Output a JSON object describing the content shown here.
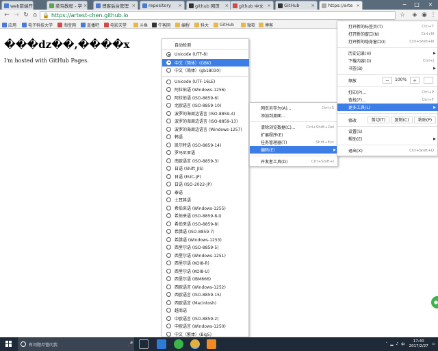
{
  "tabs": [
    {
      "title": "web前端开发"
    },
    {
      "title": "菜鸟教程 - 学"
    },
    {
      "title": "博客后台管理"
    },
    {
      "title": "repository"
    },
    {
      "title": "github 网页"
    },
    {
      "title": "github 中文"
    },
    {
      "title": "GitHub"
    },
    {
      "title": "https://arte"
    }
  ],
  "address": {
    "url": "https://artest-chen.github.io"
  },
  "bookmarks": [
    {
      "label": "应用"
    },
    {
      "label": "电子科技大学"
    },
    {
      "label": "淘宝网"
    },
    {
      "label": "直播吧"
    },
    {
      "label": "电影天堂"
    },
    {
      "label": "斗鱼"
    },
    {
      "label": "牛客网"
    },
    {
      "label": "编程"
    },
    {
      "label": "科大"
    },
    {
      "label": "GitHub"
    },
    {
      "label": "微软"
    },
    {
      "label": "博客"
    }
  ],
  "page": {
    "heading": "���dz��,����x",
    "body": "I'm hosted with GitHub Pages."
  },
  "encoding_menu": {
    "auto_detect": "自动检测",
    "items": [
      {
        "label": "Unicode (UTF-8)",
        "checked": true
      },
      {
        "label": "中文（简体）(GBK)",
        "selected": true
      },
      {
        "label": "中文（简体）(gb18030)"
      },
      {
        "label": "Unicode (UTF-16LE)"
      },
      {
        "label": "阿拉伯语 (Windows-1256)"
      },
      {
        "label": "阿拉伯语 (ISO-8859-6)"
      },
      {
        "label": "北欧语言 (ISO-8859-10)"
      },
      {
        "label": "波罗的海周边语言 (ISO-8859-4)"
      },
      {
        "label": "波罗的海周边语言 (ISO-8859-13)"
      },
      {
        "label": "波罗的海周边语言 (Windows-1257)"
      },
      {
        "label": "韩语"
      },
      {
        "label": "凯尔特语 (ISO-8859-14)"
      },
      {
        "label": "罗马尼亚语"
      },
      {
        "label": "南欧语言 (ISO-8859-3)"
      },
      {
        "label": "日语 (Shift_JIS)"
      },
      {
        "label": "日语 (EUC-JP)"
      },
      {
        "label": "日语 (ISO-2022-JP)"
      },
      {
        "label": "泰语"
      },
      {
        "label": "土耳其语"
      },
      {
        "label": "希伯来语 (Windows-1255)"
      },
      {
        "label": "希伯来语 (ISO-8859-8-I)"
      },
      {
        "label": "希伯来语 (ISO-8859-8)"
      },
      {
        "label": "希腊语 (ISO-8859-7)"
      },
      {
        "label": "希腊语 (Windows-1253)"
      },
      {
        "label": "西里尔语 (ISO-8859-5)"
      },
      {
        "label": "西里尔语 (Windows-1251)"
      },
      {
        "label": "西里尔语 (KOI8-R)"
      },
      {
        "label": "西里尔语 (KOI8-U)"
      },
      {
        "label": "西里尔语 (IBM866)"
      },
      {
        "label": "西欧语言 (Windows-1252)"
      },
      {
        "label": "西欧语言 (ISO-8859-15)"
      },
      {
        "label": "西欧语言 (Macintosh)"
      },
      {
        "label": "越南语"
      },
      {
        "label": "中欧语言 (ISO-8859-2)"
      },
      {
        "label": "中欧语言 (Windows-1250)"
      },
      {
        "label": "中文（繁体）(Big5)"
      }
    ]
  },
  "more_tools_menu": {
    "items": [
      {
        "label": "网页另存为(A)...",
        "shortcut": "Ctrl+S"
      },
      {
        "label": "添加到桌面..."
      },
      {
        "label": "清除浏览数据(C)...",
        "shortcut": "Ctrl+Shift+Del"
      },
      {
        "label": "扩展程序(E)"
      },
      {
        "label": "任务管理器(T)",
        "shortcut": "Shift+Esc"
      },
      {
        "label": "编码(E)",
        "highlighted": true
      },
      {
        "label": "开发者工具(D)",
        "shortcut": "Ctrl+Shift+I"
      }
    ]
  },
  "main_menu": {
    "new_tab": {
      "label": "打开新的标签页(T)",
      "shortcut": "Ctrl+T"
    },
    "new_window": {
      "label": "打开新的窗口(N)",
      "shortcut": "Ctrl+N"
    },
    "incognito": {
      "label": "打开新的隐身窗口(I)",
      "shortcut": "Ctrl+Shift+N"
    },
    "history": {
      "label": "历史记录(H)"
    },
    "downloads": {
      "label": "下载内容(D)",
      "shortcut": "Ctrl+J"
    },
    "bookmarks": {
      "label": "书签(B)"
    },
    "zoom": {
      "label": "缩放",
      "minus": "－",
      "value": "100%",
      "plus": "＋"
    },
    "print": {
      "label": "打印(P)...",
      "shortcut": "Ctrl+P"
    },
    "find": {
      "label": "查找(F)...",
      "shortcut": "Ctrl+F"
    },
    "more_tools": {
      "label": "更多工具(L)"
    },
    "edit": {
      "label": "修改",
      "cut": "剪切(T)",
      "copy": "复制(C)",
      "paste": "粘贴(P)"
    },
    "settings": {
      "label": "设置(S)"
    },
    "help": {
      "label": "帮助(E)"
    },
    "exit": {
      "label": "退出(X)",
      "shortcut": "Ctrl+Shift+Q"
    }
  },
  "taskbar": {
    "search_placeholder": "有问题尽管问我",
    "time": "17:40",
    "date": "2017/2/27"
  }
}
